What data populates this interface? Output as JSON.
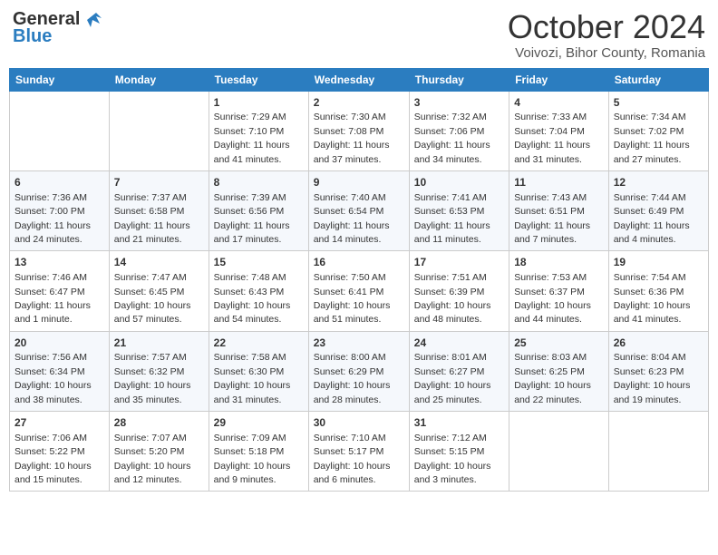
{
  "header": {
    "logo_general": "General",
    "logo_blue": "Blue",
    "title": "October 2024",
    "subtitle": "Voivozi, Bihor County, Romania"
  },
  "weekdays": [
    "Sunday",
    "Monday",
    "Tuesday",
    "Wednesday",
    "Thursday",
    "Friday",
    "Saturday"
  ],
  "weeks": [
    [
      {
        "day": "",
        "sunrise": "",
        "sunset": "",
        "daylight": ""
      },
      {
        "day": "",
        "sunrise": "",
        "sunset": "",
        "daylight": ""
      },
      {
        "day": "1",
        "sunrise": "Sunrise: 7:29 AM",
        "sunset": "Sunset: 7:10 PM",
        "daylight": "Daylight: 11 hours and 41 minutes."
      },
      {
        "day": "2",
        "sunrise": "Sunrise: 7:30 AM",
        "sunset": "Sunset: 7:08 PM",
        "daylight": "Daylight: 11 hours and 37 minutes."
      },
      {
        "day": "3",
        "sunrise": "Sunrise: 7:32 AM",
        "sunset": "Sunset: 7:06 PM",
        "daylight": "Daylight: 11 hours and 34 minutes."
      },
      {
        "day": "4",
        "sunrise": "Sunrise: 7:33 AM",
        "sunset": "Sunset: 7:04 PM",
        "daylight": "Daylight: 11 hours and 31 minutes."
      },
      {
        "day": "5",
        "sunrise": "Sunrise: 7:34 AM",
        "sunset": "Sunset: 7:02 PM",
        "daylight": "Daylight: 11 hours and 27 minutes."
      }
    ],
    [
      {
        "day": "6",
        "sunrise": "Sunrise: 7:36 AM",
        "sunset": "Sunset: 7:00 PM",
        "daylight": "Daylight: 11 hours and 24 minutes."
      },
      {
        "day": "7",
        "sunrise": "Sunrise: 7:37 AM",
        "sunset": "Sunset: 6:58 PM",
        "daylight": "Daylight: 11 hours and 21 minutes."
      },
      {
        "day": "8",
        "sunrise": "Sunrise: 7:39 AM",
        "sunset": "Sunset: 6:56 PM",
        "daylight": "Daylight: 11 hours and 17 minutes."
      },
      {
        "day": "9",
        "sunrise": "Sunrise: 7:40 AM",
        "sunset": "Sunset: 6:54 PM",
        "daylight": "Daylight: 11 hours and 14 minutes."
      },
      {
        "day": "10",
        "sunrise": "Sunrise: 7:41 AM",
        "sunset": "Sunset: 6:53 PM",
        "daylight": "Daylight: 11 hours and 11 minutes."
      },
      {
        "day": "11",
        "sunrise": "Sunrise: 7:43 AM",
        "sunset": "Sunset: 6:51 PM",
        "daylight": "Daylight: 11 hours and 7 minutes."
      },
      {
        "day": "12",
        "sunrise": "Sunrise: 7:44 AM",
        "sunset": "Sunset: 6:49 PM",
        "daylight": "Daylight: 11 hours and 4 minutes."
      }
    ],
    [
      {
        "day": "13",
        "sunrise": "Sunrise: 7:46 AM",
        "sunset": "Sunset: 6:47 PM",
        "daylight": "Daylight: 11 hours and 1 minute."
      },
      {
        "day": "14",
        "sunrise": "Sunrise: 7:47 AM",
        "sunset": "Sunset: 6:45 PM",
        "daylight": "Daylight: 10 hours and 57 minutes."
      },
      {
        "day": "15",
        "sunrise": "Sunrise: 7:48 AM",
        "sunset": "Sunset: 6:43 PM",
        "daylight": "Daylight: 10 hours and 54 minutes."
      },
      {
        "day": "16",
        "sunrise": "Sunrise: 7:50 AM",
        "sunset": "Sunset: 6:41 PM",
        "daylight": "Daylight: 10 hours and 51 minutes."
      },
      {
        "day": "17",
        "sunrise": "Sunrise: 7:51 AM",
        "sunset": "Sunset: 6:39 PM",
        "daylight": "Daylight: 10 hours and 48 minutes."
      },
      {
        "day": "18",
        "sunrise": "Sunrise: 7:53 AM",
        "sunset": "Sunset: 6:37 PM",
        "daylight": "Daylight: 10 hours and 44 minutes."
      },
      {
        "day": "19",
        "sunrise": "Sunrise: 7:54 AM",
        "sunset": "Sunset: 6:36 PM",
        "daylight": "Daylight: 10 hours and 41 minutes."
      }
    ],
    [
      {
        "day": "20",
        "sunrise": "Sunrise: 7:56 AM",
        "sunset": "Sunset: 6:34 PM",
        "daylight": "Daylight: 10 hours and 38 minutes."
      },
      {
        "day": "21",
        "sunrise": "Sunrise: 7:57 AM",
        "sunset": "Sunset: 6:32 PM",
        "daylight": "Daylight: 10 hours and 35 minutes."
      },
      {
        "day": "22",
        "sunrise": "Sunrise: 7:58 AM",
        "sunset": "Sunset: 6:30 PM",
        "daylight": "Daylight: 10 hours and 31 minutes."
      },
      {
        "day": "23",
        "sunrise": "Sunrise: 8:00 AM",
        "sunset": "Sunset: 6:29 PM",
        "daylight": "Daylight: 10 hours and 28 minutes."
      },
      {
        "day": "24",
        "sunrise": "Sunrise: 8:01 AM",
        "sunset": "Sunset: 6:27 PM",
        "daylight": "Daylight: 10 hours and 25 minutes."
      },
      {
        "day": "25",
        "sunrise": "Sunrise: 8:03 AM",
        "sunset": "Sunset: 6:25 PM",
        "daylight": "Daylight: 10 hours and 22 minutes."
      },
      {
        "day": "26",
        "sunrise": "Sunrise: 8:04 AM",
        "sunset": "Sunset: 6:23 PM",
        "daylight": "Daylight: 10 hours and 19 minutes."
      }
    ],
    [
      {
        "day": "27",
        "sunrise": "Sunrise: 7:06 AM",
        "sunset": "Sunset: 5:22 PM",
        "daylight": "Daylight: 10 hours and 15 minutes."
      },
      {
        "day": "28",
        "sunrise": "Sunrise: 7:07 AM",
        "sunset": "Sunset: 5:20 PM",
        "daylight": "Daylight: 10 hours and 12 minutes."
      },
      {
        "day": "29",
        "sunrise": "Sunrise: 7:09 AM",
        "sunset": "Sunset: 5:18 PM",
        "daylight": "Daylight: 10 hours and 9 minutes."
      },
      {
        "day": "30",
        "sunrise": "Sunrise: 7:10 AM",
        "sunset": "Sunset: 5:17 PM",
        "daylight": "Daylight: 10 hours and 6 minutes."
      },
      {
        "day": "31",
        "sunrise": "Sunrise: 7:12 AM",
        "sunset": "Sunset: 5:15 PM",
        "daylight": "Daylight: 10 hours and 3 minutes."
      },
      {
        "day": "",
        "sunrise": "",
        "sunset": "",
        "daylight": ""
      },
      {
        "day": "",
        "sunrise": "",
        "sunset": "",
        "daylight": ""
      }
    ]
  ]
}
